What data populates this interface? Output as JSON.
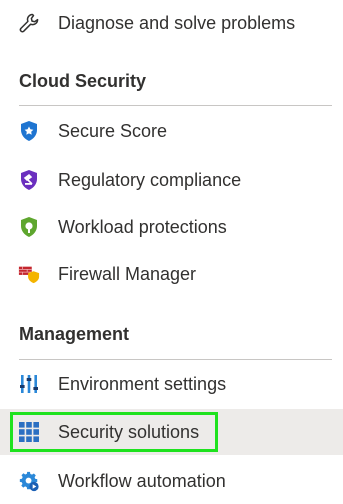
{
  "items_top": [
    {
      "label": "Diagnose and solve problems",
      "icon": "wrench-icon"
    }
  ],
  "sections": [
    {
      "title": "Cloud Security",
      "items": [
        {
          "label": "Secure Score",
          "icon": "secure-score-shield-icon"
        },
        {
          "label": "Regulatory compliance",
          "icon": "regulatory-compliance-shield-icon"
        },
        {
          "label": "Workload protections",
          "icon": "workload-protections-shield-icon"
        },
        {
          "label": "Firewall Manager",
          "icon": "firewall-manager-icon"
        }
      ]
    },
    {
      "title": "Management",
      "items": [
        {
          "label": "Environment settings",
          "icon": "environment-settings-icon"
        },
        {
          "label": "Security solutions",
          "icon": "security-solutions-grid-icon",
          "selected": true
        },
        {
          "label": "Workflow automation",
          "icon": "workflow-automation-gear-icon"
        }
      ]
    }
  ],
  "colors": {
    "selected_bg": "#edebe9",
    "highlight_outline": "#1ee21e",
    "text": "#323130",
    "divider": "#c8c6c4"
  }
}
